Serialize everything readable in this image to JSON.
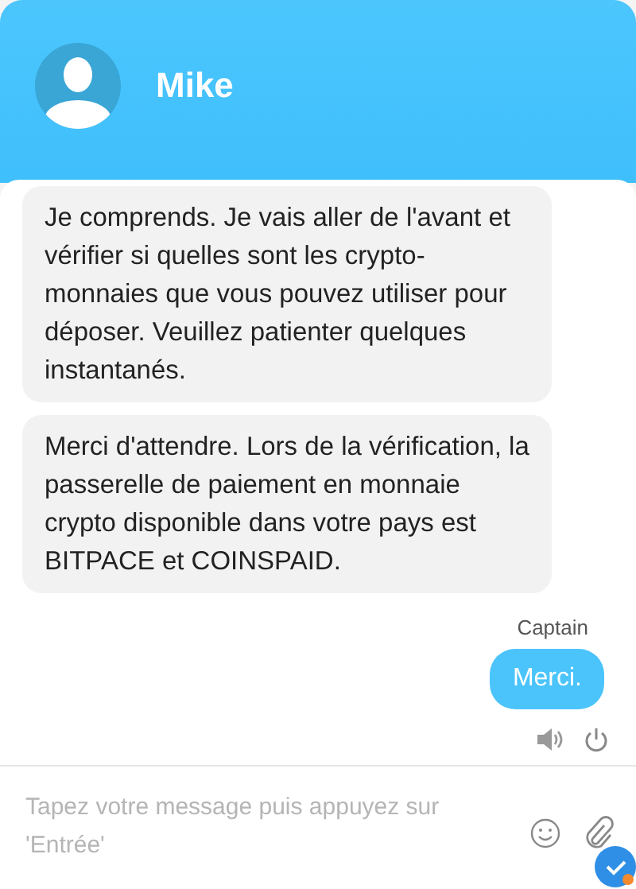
{
  "header": {
    "name": "Mike"
  },
  "messages": [
    {
      "kind": "agent",
      "text": "Je comprends. Je vais aller de l'avant et vérifier si quelles sont les crypto-monnaies que vous pouvez utiliser pour déposer. Veuillez patienter quelques instantanés."
    },
    {
      "kind": "agent",
      "text": "Merci d'attendre. Lors de la vérification, la passerelle de paiement en monnaie crypto disponible dans votre pays est BITPACE et COINSPAID."
    },
    {
      "kind": "visitor",
      "sender": "Captain",
      "text": "Merci."
    }
  ],
  "composer": {
    "placeholder": "Tapez votre message puis appuyez sur 'Entrée'"
  }
}
